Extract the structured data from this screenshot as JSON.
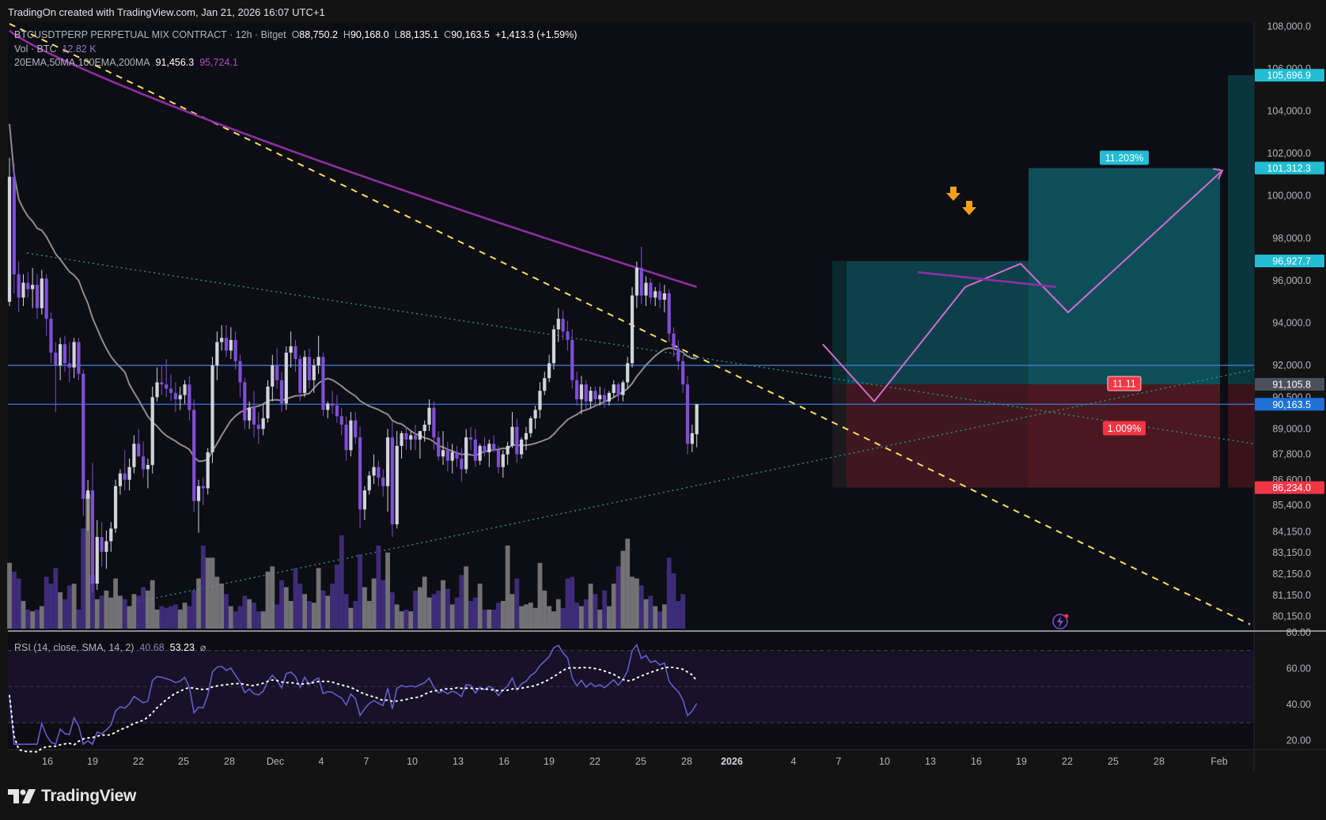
{
  "header": {
    "created_by": "TradingOn created with TradingView.com, Jan 21, 2026 16:07 UTC+1"
  },
  "legend": {
    "symbol": "BTCUSDTPERP PERPETUAL MIX CONTRACT · 12h · Bitget",
    "o_label": "O",
    "o": "88,750.2",
    "h_label": "H",
    "h": "90,168.0",
    "l_label": "L",
    "l": "88,135.1",
    "c_label": "C",
    "c": "90,163.5",
    "change": "+1,413.3 (+1.59%)",
    "vol_label": "Vol · BTC",
    "vol_value": "12.82 K",
    "ma_label": "20EMA,50MA,100EMA,200MA",
    "ma1": "91,456.3",
    "ma2": "95,724.1",
    "rsi_label": "RSI (14, close, SMA, 14, 2)",
    "rsi_value": "40.68",
    "rsi_sma": "53.23",
    "rsi_extra": "⌀"
  },
  "brand": {
    "name": "TradingView"
  },
  "colors": {
    "bg": "#131313",
    "panel": "#0d0d14",
    "up": "#d1d4dc",
    "down": "#7e4fd6",
    "vol_up": "#8c8c8c",
    "vol_down": "#4a3591",
    "ma200": "#8e2ea3",
    "ma50": "#8d8d8d",
    "hline": "#3d7ad6",
    "target": "#2ad0e6",
    "stop": "#f23645",
    "trend": "#f6e05e",
    "rsi": "#6a5acd"
  },
  "chart_data": {
    "type": "candlestick",
    "symbol": "BTCUSDTPERP",
    "timeframe": "12h",
    "ylim": [
      79500,
      108200
    ],
    "price_ticks": [
      "108,000.0",
      "106,000.0",
      "104,000.0",
      "102,000.0",
      "100,000.0",
      "98,000.0",
      "96,000.0",
      "94,000.0",
      "92,000.0",
      "90,500.0",
      "89,000.0",
      "87,800.0",
      "86,600.0",
      "85,400.0",
      "84,150.0",
      "83,150.0",
      "82,150.0",
      "81,150.0",
      "80,150.0"
    ],
    "tick_values": [
      108000,
      106000,
      104000,
      102000,
      100000,
      98000,
      96000,
      94000,
      92000,
      90500,
      89000,
      87800,
      86600,
      85400,
      84150,
      83150,
      82150,
      81150,
      80150
    ],
    "x_ticks": [
      "16",
      "19",
      "22",
      "25",
      "28",
      "Dec",
      "4",
      "7",
      "10",
      "13",
      "16",
      "19",
      "22",
      "25",
      "28",
      "2026",
      "4",
      "7",
      "10",
      "13",
      "16",
      "19",
      "22",
      "25",
      "28",
      "Feb"
    ],
    "price_labels": [
      {
        "text": "105,696.9",
        "value": 105697,
        "kind": "target"
      },
      {
        "text": "101,312.3",
        "value": 101312,
        "kind": "target"
      },
      {
        "text": "96,927.7",
        "value": 96928,
        "kind": "target"
      },
      {
        "text": "91,105.8",
        "value": 91106,
        "kind": "entry"
      },
      {
        "text": "90,163.5",
        "value": 90164,
        "kind": "last"
      },
      {
        "text": "86,234.0",
        "value": 86234,
        "kind": "stop"
      }
    ],
    "horizontal_lines": [
      92000,
      90164
    ],
    "position_labels": [
      {
        "text": "11.203%",
        "kind": "target"
      },
      {
        "text": "11.11",
        "kind": "stop"
      },
      {
        "text": "1.009%",
        "kind": "stop"
      }
    ],
    "candles": [
      [
        95000,
        101800,
        94800,
        100900
      ],
      [
        100900,
        101500,
        95400,
        96300
      ],
      [
        96300,
        96900,
        94500,
        95200
      ],
      [
        95200,
        96300,
        94800,
        95900
      ],
      [
        95900,
        96400,
        95200,
        95600
      ],
      [
        95600,
        96600,
        94700,
        95800
      ],
      [
        95800,
        96300,
        94200,
        94700
      ],
      [
        94700,
        96500,
        94400,
        96100
      ],
      [
        96100,
        96300,
        93400,
        94200
      ],
      [
        94200,
        94500,
        92100,
        92600
      ],
      [
        92600,
        93100,
        89800,
        92000
      ],
      [
        92000,
        93300,
        91300,
        93000
      ],
      [
        93000,
        93400,
        91700,
        92100
      ],
      [
        92100,
        93100,
        91200,
        91900
      ],
      [
        91900,
        93300,
        91400,
        93100
      ],
      [
        93100,
        93300,
        91300,
        91600
      ],
      [
        91600,
        91800,
        84900,
        85700
      ],
      [
        85700,
        86600,
        84200,
        86100
      ],
      [
        86100,
        87400,
        81300,
        81700
      ],
      [
        81700,
        84700,
        81400,
        83900
      ],
      [
        83900,
        84600,
        82500,
        83200
      ],
      [
        83200,
        84200,
        82400,
        83700
      ],
      [
        83700,
        84600,
        83200,
        84300
      ],
      [
        84300,
        86600,
        84100,
        86300
      ],
      [
        86300,
        87100,
        85900,
        86900
      ],
      [
        86900,
        88000,
        86100,
        86600
      ],
      [
        86600,
        87600,
        86100,
        87200
      ],
      [
        87200,
        88700,
        86900,
        88300
      ],
      [
        88300,
        89000,
        87800,
        87700
      ],
      [
        87700,
        88400,
        86700,
        87100
      ],
      [
        87100,
        87600,
        86200,
        87300
      ],
      [
        87300,
        91000,
        86900,
        90500
      ],
      [
        90500,
        91900,
        90300,
        91200
      ],
      [
        91200,
        92000,
        90600,
        91100
      ],
      [
        91100,
        92300,
        90500,
        90900
      ],
      [
        90900,
        91600,
        90300,
        90700
      ],
      [
        90700,
        91200,
        89800,
        90400
      ],
      [
        90400,
        91000,
        89900,
        90600
      ],
      [
        90600,
        91300,
        90200,
        91100
      ],
      [
        91100,
        91500,
        89400,
        89900
      ],
      [
        89900,
        90400,
        85100,
        85600
      ],
      [
        85600,
        86600,
        84100,
        86300
      ],
      [
        86300,
        86700,
        85400,
        86200
      ],
      [
        86200,
        88100,
        85900,
        87900
      ],
      [
        87900,
        92400,
        87400,
        92000
      ],
      [
        92000,
        93600,
        91300,
        93100
      ],
      [
        93100,
        93900,
        92700,
        93300
      ],
      [
        93300,
        93900,
        92400,
        92700
      ],
      [
        92700,
        93800,
        92300,
        93200
      ],
      [
        93200,
        93600,
        91800,
        92200
      ],
      [
        92200,
        92500,
        90500,
        91200
      ],
      [
        91200,
        91400,
        89000,
        89400
      ],
      [
        89400,
        90300,
        89000,
        90000
      ],
      [
        90000,
        90800,
        88600,
        89200
      ],
      [
        89200,
        89800,
        88300,
        89000
      ],
      [
        89000,
        90200,
        88700,
        89500
      ],
      [
        89500,
        91300,
        89300,
        91000
      ],
      [
        91000,
        92500,
        90300,
        92000
      ],
      [
        92000,
        92800,
        90900,
        91300
      ],
      [
        91300,
        91700,
        89800,
        90200
      ],
      [
        90200,
        92900,
        89900,
        92600
      ],
      [
        92600,
        93600,
        91900,
        92900
      ],
      [
        92900,
        93200,
        91700,
        92300
      ],
      [
        92300,
        92500,
        90300,
        90700
      ],
      [
        90700,
        92700,
        90500,
        92400
      ],
      [
        92400,
        92800,
        90900,
        91300
      ],
      [
        91300,
        92300,
        90700,
        92000
      ],
      [
        92000,
        93400,
        91600,
        92400
      ],
      [
        92400,
        92600,
        89600,
        89900
      ],
      [
        89900,
        90300,
        89500,
        90200
      ],
      [
        90200,
        90800,
        89700,
        90100
      ],
      [
        90100,
        90600,
        89300,
        89600
      ],
      [
        89600,
        90000,
        88700,
        89200
      ],
      [
        89200,
        89600,
        87500,
        88000
      ],
      [
        88000,
        89800,
        87700,
        89400
      ],
      [
        89400,
        89800,
        88300,
        88600
      ],
      [
        88600,
        89100,
        84300,
        85200
      ],
      [
        85200,
        86300,
        84700,
        86100
      ],
      [
        86100,
        87000,
        85900,
        86800
      ],
      [
        86800,
        87800,
        86400,
        87200
      ],
      [
        87200,
        87500,
        86300,
        86700
      ],
      [
        86700,
        87100,
        85800,
        86300
      ],
      [
        86300,
        89000,
        85100,
        88600
      ],
      [
        88600,
        89400,
        83900,
        84500
      ],
      [
        84500,
        88900,
        84300,
        88200
      ],
      [
        88200,
        88900,
        87600,
        88800
      ],
      [
        88800,
        89100,
        88000,
        88500
      ],
      [
        88500,
        88900,
        88000,
        88700
      ],
      [
        88700,
        89200,
        88000,
        88500
      ],
      [
        88500,
        88900,
        87600,
        88900
      ],
      [
        88900,
        89400,
        88400,
        89200
      ],
      [
        89200,
        90400,
        88900,
        90000
      ],
      [
        90000,
        90300,
        88000,
        88600
      ],
      [
        88600,
        88900,
        87500,
        87700
      ],
      [
        87700,
        88900,
        87300,
        88000
      ],
      [
        88000,
        88400,
        87000,
        87500
      ],
      [
        87500,
        88300,
        86900,
        87900
      ],
      [
        87900,
        88200,
        87200,
        87600
      ],
      [
        87600,
        88100,
        86500,
        87100
      ],
      [
        87100,
        89000,
        86900,
        88600
      ],
      [
        88600,
        89100,
        88000,
        88500
      ],
      [
        88500,
        89000,
        87200,
        87500
      ],
      [
        87500,
        88300,
        87300,
        88200
      ],
      [
        88200,
        88600,
        87700,
        87900
      ],
      [
        87900,
        88500,
        87200,
        88300
      ],
      [
        88300,
        88700,
        87900,
        88000
      ],
      [
        88000,
        88200,
        86900,
        87200
      ],
      [
        87200,
        88000,
        86700,
        87800
      ],
      [
        87800,
        88400,
        87300,
        88200
      ],
      [
        88200,
        89800,
        88100,
        89100
      ],
      [
        89100,
        89500,
        87400,
        87800
      ],
      [
        87800,
        88600,
        87600,
        88500
      ],
      [
        88500,
        89100,
        88000,
        88800
      ],
      [
        88800,
        89600,
        88600,
        89500
      ],
      [
        89500,
        90100,
        89000,
        89900
      ],
      [
        89900,
        91200,
        89500,
        90800
      ],
      [
        90800,
        91700,
        90600,
        91400
      ],
      [
        91400,
        92500,
        91200,
        92100
      ],
      [
        92100,
        93900,
        91800,
        93700
      ],
      [
        93700,
        94700,
        93100,
        94200
      ],
      [
        94200,
        94600,
        93200,
        93600
      ],
      [
        93600,
        94100,
        92700,
        93200
      ],
      [
        93200,
        93700,
        90900,
        91300
      ],
      [
        91300,
        91700,
        90100,
        90400
      ],
      [
        90400,
        91500,
        89700,
        91100
      ],
      [
        91100,
        91300,
        89900,
        90300
      ],
      [
        90300,
        91000,
        90000,
        90800
      ],
      [
        90800,
        91000,
        90100,
        90400
      ],
      [
        90400,
        91000,
        90100,
        90600
      ],
      [
        90600,
        90900,
        90000,
        90300
      ],
      [
        90300,
        90800,
        90100,
        90700
      ],
      [
        90700,
        91300,
        90500,
        91100
      ],
      [
        91100,
        91200,
        90300,
        90600
      ],
      [
        90600,
        91300,
        90300,
        91200
      ],
      [
        91200,
        92400,
        90900,
        92100
      ],
      [
        92100,
        95700,
        91900,
        95300
      ],
      [
        95300,
        96900,
        94700,
        96600
      ],
      [
        96600,
        97600,
        94900,
        95300
      ],
      [
        95300,
        96200,
        94800,
        95900
      ],
      [
        95900,
        96100,
        94900,
        95200
      ],
      [
        95200,
        95700,
        94800,
        95500
      ],
      [
        95500,
        95900,
        94700,
        95100
      ],
      [
        95100,
        95800,
        94500,
        95400
      ],
      [
        95400,
        95600,
        93100,
        93500
      ],
      [
        93500,
        93800,
        92400,
        92800
      ],
      [
        92800,
        93200,
        91800,
        92200
      ],
      [
        92200,
        92500,
        90700,
        91100
      ],
      [
        91100,
        91500,
        87800,
        88300
      ],
      [
        88300,
        89200,
        87900,
        88800
      ],
      [
        88750,
        90168,
        88135,
        90163
      ]
    ],
    "volume": {
      "ylim": [
        0,
        80
      ],
      "unit": "K BTC",
      "last": 12.82
    },
    "volumes": [
      38,
      33,
      29,
      16,
      11,
      10,
      11,
      13,
      30,
      26,
      35,
      21,
      17,
      25,
      26,
      11,
      58,
      78,
      31,
      17,
      19,
      22,
      18,
      29,
      19,
      17,
      13,
      20,
      19,
      24,
      22,
      28,
      11,
      13,
      12,
      13,
      14,
      11,
      15,
      13,
      22,
      29,
      48,
      41,
      41,
      30,
      26,
      20,
      13,
      10,
      13,
      19,
      17,
      15,
      10,
      10,
      33,
      36,
      14,
      28,
      24,
      16,
      35,
      26,
      20,
      16,
      15,
      35,
      22,
      19,
      26,
      37,
      54,
      20,
      12,
      16,
      43,
      24,
      16,
      29,
      48,
      28,
      44,
      21,
      14,
      10,
      11,
      10,
      22,
      24,
      30,
      18,
      20,
      22,
      28,
      23,
      14,
      18,
      31,
      36,
      16,
      18,
      26,
      11,
      11,
      11,
      15,
      16,
      48,
      20,
      29,
      13,
      14,
      15,
      12,
      38,
      22,
      13,
      10,
      17,
      12,
      29,
      30,
      15,
      13,
      17,
      26,
      20,
      11,
      22,
      13,
      26,
      36,
      45,
      52,
      30,
      29,
      25,
      17,
      19,
      13,
      10,
      14,
      41,
      32,
      16,
      20
    ],
    "rsi": {
      "ylim": [
        15,
        80
      ],
      "levels": [
        70,
        50,
        30
      ],
      "ticks": [
        "80.00",
        "60.00",
        "40.00",
        "20.00"
      ],
      "tick_values": [
        80,
        60,
        40,
        20
      ],
      "value": 40.68,
      "sma": 53.23
    }
  }
}
